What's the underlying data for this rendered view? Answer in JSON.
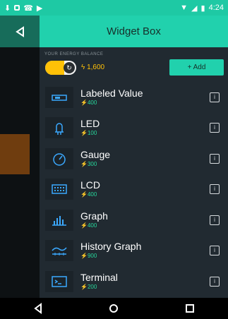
{
  "status_bar": {
    "time": "4:24"
  },
  "header": {
    "title": "Widget Box"
  },
  "energy": {
    "label": "YOUR ENERGY BALANCE",
    "value": "1,600",
    "battery_fill_fraction": 0.62
  },
  "add_button": {
    "label": "+ Add"
  },
  "widgets": [
    {
      "name": "Labeled Value",
      "cost": "400",
      "icon": "labeled-value-icon"
    },
    {
      "name": "LED",
      "cost": "100",
      "icon": "led-icon"
    },
    {
      "name": "Gauge",
      "cost": "300",
      "icon": "gauge-icon"
    },
    {
      "name": "LCD",
      "cost": "400",
      "icon": "lcd-icon"
    },
    {
      "name": "Graph",
      "cost": "400",
      "icon": "graph-icon"
    },
    {
      "name": "History Graph",
      "cost": "900",
      "icon": "history-graph-icon"
    },
    {
      "name": "Terminal",
      "cost": "200",
      "icon": "terminal-icon"
    }
  ],
  "colors": {
    "accent": "#21d1ad",
    "energy": "#ffc107",
    "cost": "#27d69b"
  }
}
